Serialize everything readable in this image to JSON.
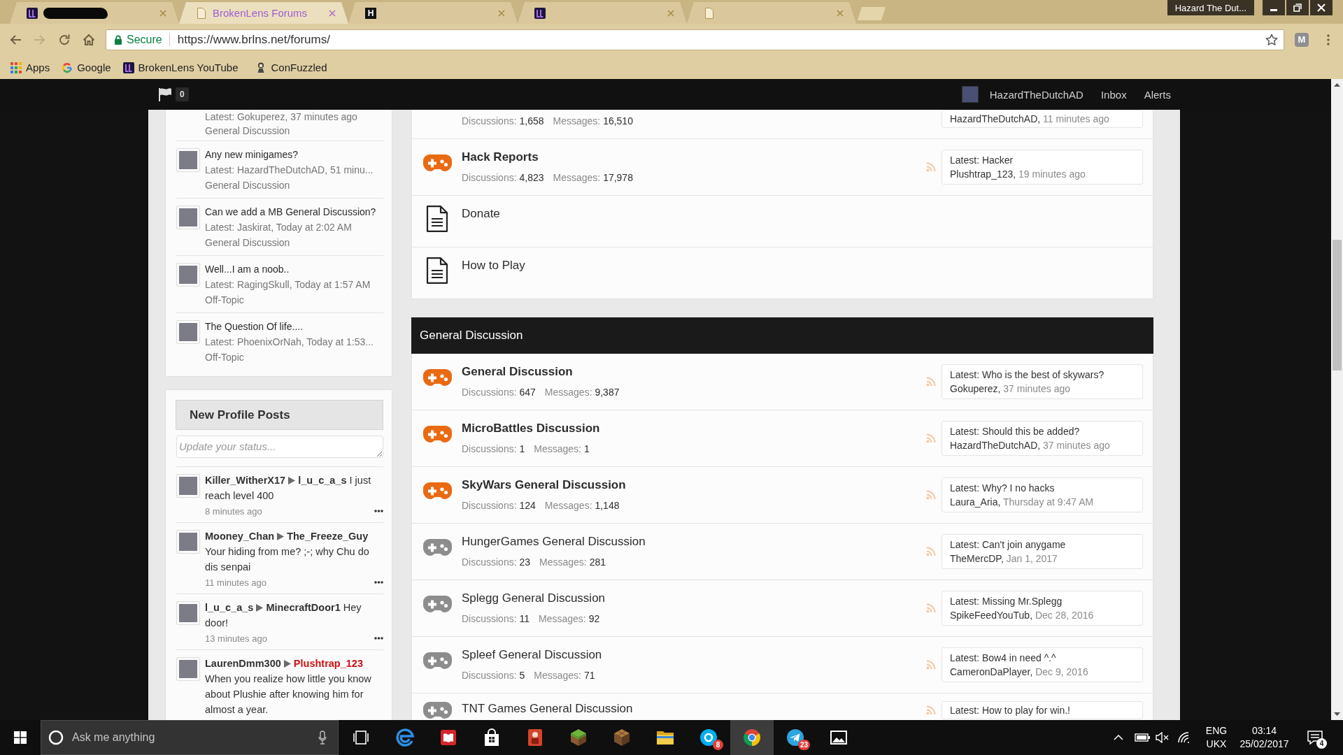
{
  "browser": {
    "tabs": [
      {
        "kind": "logo",
        "redacted": true,
        "selected": false
      },
      {
        "kind": "page",
        "title": "BrokenLens Forums",
        "selected": true
      },
      {
        "kind": "letter",
        "favicon_letter": "H",
        "selected": false
      },
      {
        "kind": "logo",
        "selected": false
      },
      {
        "kind": "page",
        "selected": false
      }
    ],
    "profile_button": "Hazard The Dut...",
    "forward_disabled": true,
    "address_bar": {
      "security_label": "Secure",
      "url": "https://www.brlns.net/forums/"
    },
    "extension_letter": "M",
    "bookmarks": [
      {
        "kind": "apps",
        "label": "Apps"
      },
      {
        "kind": "google",
        "label": "Google"
      },
      {
        "kind": "logo",
        "label": "BrokenLens YouTube"
      },
      {
        "kind": "character",
        "label": "ConFuzzled"
      }
    ]
  },
  "site_nav": {
    "flag_count": "0",
    "username": "HazardTheDutchAD",
    "links": [
      "Inbox",
      "Alerts"
    ]
  },
  "sidebar": {
    "threads": [
      {
        "latest": "Latest: Gokuperez, 37 minutes ago",
        "forum": "General Discussion"
      },
      {
        "title": "Any new minigames?",
        "latest": "Latest: HazardTheDutchAD, 51 minu...",
        "forum": "General Discussion"
      },
      {
        "title": "Can we add a MB General Discussion?",
        "latest": "Latest: Jaskirat, Today at 2:02 AM",
        "forum": "General Discussion"
      },
      {
        "title": "Well...I am a noob..",
        "latest": "Latest: RagingSkull, Today at 1:57 AM",
        "forum": "Off-Topic"
      },
      {
        "title": "The Question Of life....",
        "latest": "Latest: PhoenixOrNah, Today at 1:53...",
        "forum": "Off-Topic"
      }
    ],
    "profile_posts": {
      "title": "New Profile Posts",
      "status_placeholder": "Update your status...",
      "posts": [
        {
          "author": "Killer_WitherX17",
          "target": "l_u_c_a_s",
          "target_highlighted": false,
          "message": "I just reach level 400",
          "time": "8 minutes ago"
        },
        {
          "author": "Mooney_Chan",
          "target": "The_Freeze_Guy",
          "target_highlighted": false,
          "message": "Your hiding from me? ;-; why Chu do dis senpai",
          "time": "11 minutes ago"
        },
        {
          "author": "l_u_c_a_s",
          "target": "MinecraftDoor1",
          "target_highlighted": false,
          "message": "Hey door!",
          "time": "13 minutes ago"
        },
        {
          "author": "LaurenDmm300",
          "target": "Plushtrap_123",
          "target_highlighted": true,
          "message": "When you realize how little you know about Plushie after knowing him for almost a year."
        }
      ]
    }
  },
  "forums": {
    "sections": [
      {
        "nodes": [
          {
            "kind": "forum",
            "stats": [
              {
                "label": "Discussions:",
                "value": "1,658"
              },
              {
                "label": "Messages:",
                "value": "16,510"
              }
            ],
            "latest_user": "HazardTheDutchAD,",
            "latest_time": "11 minutes ago"
          },
          {
            "kind": "forum",
            "title": "Hack Reports",
            "unread": true,
            "stats": [
              {
                "label": "Discussions:",
                "value": "4,823"
              },
              {
                "label": "Messages:",
                "value": "17,978"
              }
            ],
            "latest": "Latest: Hacker",
            "latest_user": "Plushtrap_123,",
            "latest_time": "19 minutes ago"
          },
          {
            "kind": "link",
            "title": "Donate"
          },
          {
            "kind": "link",
            "title": "How to Play"
          }
        ]
      },
      {
        "title": "General Discussion",
        "nodes": [
          {
            "kind": "forum",
            "title": "General Discussion",
            "unread": true,
            "stats": [
              {
                "label": "Discussions:",
                "value": "647"
              },
              {
                "label": "Messages:",
                "value": "9,387"
              }
            ],
            "latest": "Latest: Who is the best of skywars?",
            "latest_user": "Gokuperez,",
            "latest_time": "37 minutes ago"
          },
          {
            "kind": "forum",
            "title": "MicroBattles Discussion",
            "unread": true,
            "stats": [
              {
                "label": "Discussions:",
                "value": "1"
              },
              {
                "label": "Messages:",
                "value": "1"
              }
            ],
            "latest": "Latest: Should this be added?",
            "latest_user": "HazardTheDutchAD,",
            "latest_time": "37 minutes ago"
          },
          {
            "kind": "forum",
            "title": "SkyWars General Discussion",
            "unread": true,
            "stats": [
              {
                "label": "Discussions:",
                "value": "124"
              },
              {
                "label": "Messages:",
                "value": "1,148"
              }
            ],
            "latest": "Latest: Why? I no hacks",
            "latest_user": "Laura_Aria,",
            "latest_time": "Thursday at 9:47 AM"
          },
          {
            "kind": "forum",
            "title": "HungerGames General Discussion",
            "unread": false,
            "stats": [
              {
                "label": "Discussions:",
                "value": "23"
              },
              {
                "label": "Messages:",
                "value": "281"
              }
            ],
            "latest": "Latest: Can't join anygame",
            "latest_user": "TheMercDP,",
            "latest_time": "Jan 1, 2017"
          },
          {
            "kind": "forum",
            "title": "Splegg General Discussion",
            "unread": false,
            "stats": [
              {
                "label": "Discussions:",
                "value": "11"
              },
              {
                "label": "Messages:",
                "value": "92"
              }
            ],
            "latest": "Latest: Missing Mr.Splegg",
            "latest_user": "SpikeFeedYouTub,",
            "latest_time": "Dec 28, 2016"
          },
          {
            "kind": "forum",
            "title": "Spleef General Discussion",
            "unread": false,
            "stats": [
              {
                "label": "Discussions:",
                "value": "5"
              },
              {
                "label": "Messages:",
                "value": "71"
              }
            ],
            "latest": "Latest: Bow4 in need ^.^",
            "latest_user": "CameronDaPlayer,",
            "latest_time": "Dec 9, 2016"
          },
          {
            "kind": "forum",
            "title": "TNT Games General Discussion",
            "unread": false,
            "latest": "Latest: How to play for win.!"
          }
        ]
      }
    ]
  },
  "taskbar": {
    "search_placeholder": "Ask me anything",
    "apps": [
      {
        "kind": "edge",
        "selected": false
      },
      {
        "kind": "reader",
        "selected": false
      },
      {
        "kind": "store",
        "selected": false
      },
      {
        "kind": "red-app",
        "selected": false
      },
      {
        "kind": "grass-block",
        "selected": false
      },
      {
        "kind": "crafting-block",
        "selected": false
      },
      {
        "kind": "folder",
        "selected": false
      },
      {
        "kind": "skype",
        "badge": "8",
        "selected": false
      },
      {
        "kind": "chrome",
        "selected": true
      },
      {
        "kind": "telegram",
        "badge": "23",
        "selected": false
      },
      {
        "kind": "photos",
        "selected": false
      }
    ],
    "tray": {
      "language": "ENG",
      "layout": "UKX",
      "time": "03:14",
      "date": "25/02/2017",
      "notification_count": "4"
    }
  }
}
